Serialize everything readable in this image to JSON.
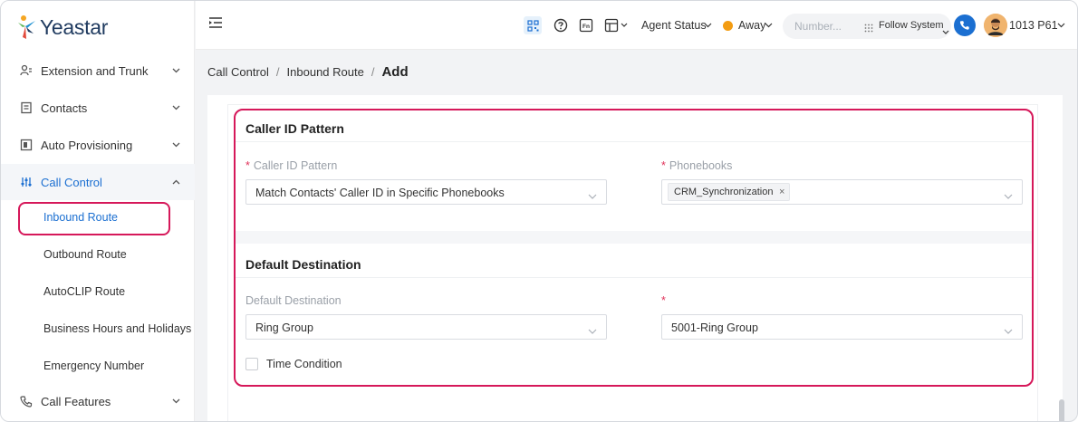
{
  "app": {
    "logo_text": "Yeastar"
  },
  "sidebar": {
    "items": [
      {
        "label": "Extension and Trunk",
        "icon": "user-list-icon"
      },
      {
        "label": "Contacts",
        "icon": "contacts-book-icon"
      },
      {
        "label": "Auto Provisioning",
        "icon": "provisioning-icon"
      },
      {
        "label": "Call Control",
        "icon": "call-control-icon"
      }
    ],
    "call_control_sub": [
      {
        "label": "Inbound Route"
      },
      {
        "label": "Outbound Route"
      },
      {
        "label": "AutoCLIP Route"
      },
      {
        "label": "Business Hours and Holidays"
      },
      {
        "label": "Emergency Number"
      }
    ],
    "bottom_item": {
      "label": "Call Features",
      "icon": "call-features-icon"
    }
  },
  "header": {
    "agent_status_label": "Agent Status",
    "presence_label": "Away",
    "search_placeholder": "Number...",
    "follow_label": "Follow System",
    "user_label": "1013 P61"
  },
  "breadcrumb": {
    "items": [
      "Call Control",
      "Inbound Route"
    ],
    "current": "Add"
  },
  "caller_id_section": {
    "title": "Caller ID Pattern",
    "pattern_label": "Caller ID Pattern",
    "pattern_value": "Match Contacts' Caller ID in Specific Phonebooks",
    "phonebooks_label": "Phonebooks",
    "phonebooks_tag": "CRM_Synchronization",
    "tag_remove": "×"
  },
  "destination_section": {
    "title": "Default Destination",
    "dest_label": "Default Destination",
    "dest_value": "Ring Group",
    "target_value": "5001-Ring Group",
    "time_condition_label": "Time Condition"
  },
  "colors": {
    "accent": "#1b6fd1",
    "highlight": "#d6185a",
    "required": "#e0325a"
  }
}
